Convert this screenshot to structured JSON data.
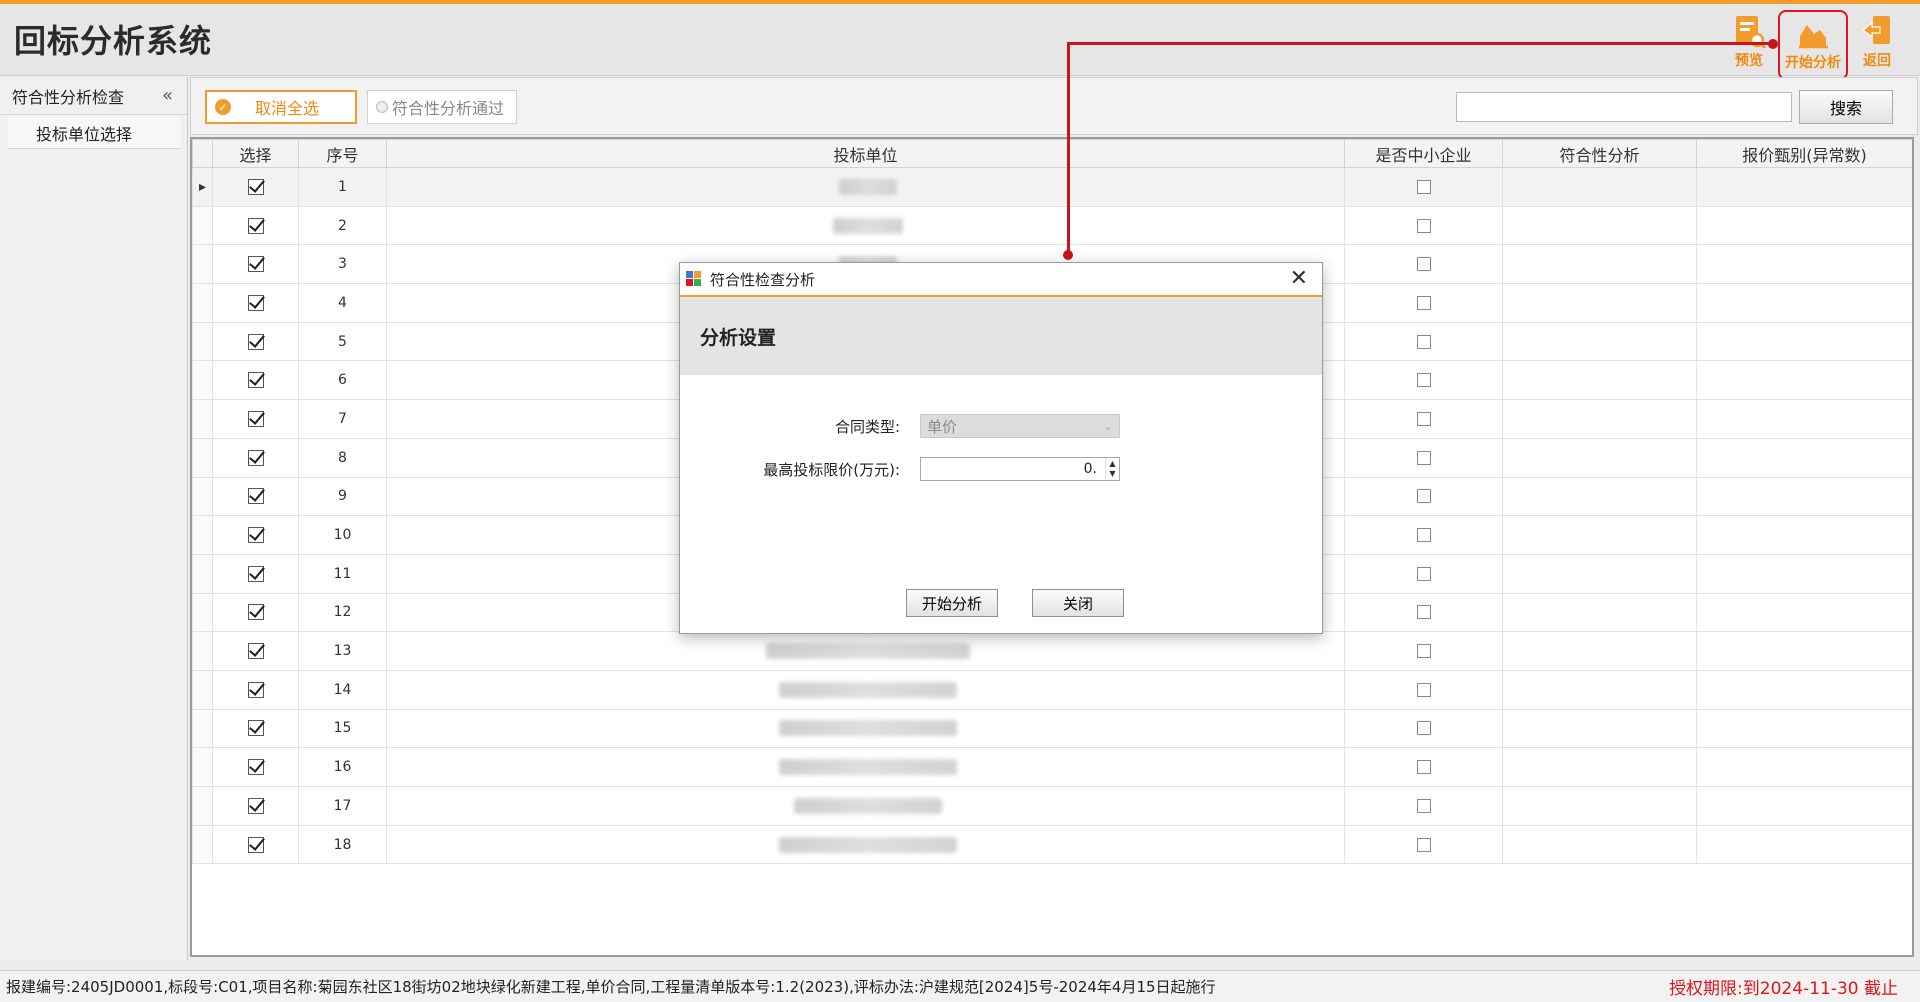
{
  "app": {
    "title": "回标分析系统"
  },
  "toolbar": {
    "preview_label": "预览",
    "analyze_label": "开始分析",
    "back_label": "返回"
  },
  "sidebar": {
    "header": "符合性分析检查",
    "collapse_glyph": "«",
    "items": [
      {
        "label": "投标单位选择"
      }
    ]
  },
  "filter": {
    "deselect_all": "取消全选",
    "pass_checkbox": "符合性分析通过",
    "search_value": "",
    "search_button": "搜索"
  },
  "table": {
    "columns": [
      "选择",
      "序号",
      "投标单位",
      "是否中小企业",
      "符合性分析",
      "报价甄别(异常数)"
    ],
    "rows": [
      {
        "selected": true,
        "no": "1",
        "sme": false
      },
      {
        "selected": true,
        "no": "2",
        "sme": false
      },
      {
        "selected": true,
        "no": "3",
        "sme": false
      },
      {
        "selected": true,
        "no": "4",
        "sme": false
      },
      {
        "selected": true,
        "no": "5",
        "sme": false
      },
      {
        "selected": true,
        "no": "6",
        "sme": false
      },
      {
        "selected": true,
        "no": "7",
        "sme": false
      },
      {
        "selected": true,
        "no": "8",
        "sme": false
      },
      {
        "selected": true,
        "no": "9",
        "sme": false
      },
      {
        "selected": true,
        "no": "10",
        "sme": false
      },
      {
        "selected": true,
        "no": "11",
        "sme": false
      },
      {
        "selected": true,
        "no": "12",
        "sme": false
      },
      {
        "selected": true,
        "no": "13",
        "sme": false
      },
      {
        "selected": true,
        "no": "14",
        "sme": false
      },
      {
        "selected": true,
        "no": "15",
        "sme": false
      },
      {
        "selected": true,
        "no": "16",
        "sme": false
      },
      {
        "selected": true,
        "no": "17",
        "sme": false
      },
      {
        "selected": true,
        "no": "18",
        "sme": false
      }
    ]
  },
  "dialog": {
    "title": "符合性检查分析",
    "heading": "分析设置",
    "contract_type_label": "合同类型:",
    "contract_type_value": "单价",
    "max_price_label": "最高投标限价(万元):",
    "max_price_value": "0.",
    "start_button": "开始分析",
    "close_button": "关闭"
  },
  "status": {
    "info": "报建编号:2405JD0001,标段号:C01,项目名称:菊园东社区18街坊02地块绿化新建工程,单价合同,工程量清单版本号:1.2(2023),评标办法:沪建规范[2024]5号-2024年4月15日起施行",
    "license": "授权期限:到2024-11-30 截止"
  },
  "colors": {
    "accent": "#f39c2e",
    "annotation": "#c8141c",
    "license": "#e0141c"
  }
}
